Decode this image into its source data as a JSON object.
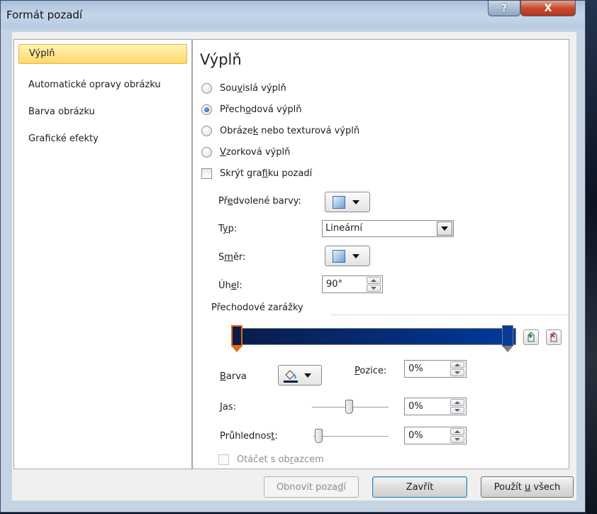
{
  "window": {
    "title": "Formát pozadí",
    "help_label": "?",
    "close_label": "X"
  },
  "nav": {
    "items": [
      {
        "label": "Výplň",
        "selected": true
      },
      {
        "label": "Automatické opravy obrázku",
        "selected": false
      },
      {
        "label": "Barva obrázku",
        "selected": false
      },
      {
        "label": "Grafické efekty",
        "selected": false
      }
    ]
  },
  "fill": {
    "heading": "Výplň",
    "options": [
      {
        "pre": "Sou",
        "ul": "v",
        "post": "islá výplň",
        "selected": false
      },
      {
        "pre": "Přech",
        "ul": "o",
        "post": "dová výplň",
        "selected": true
      },
      {
        "pre": "Obráze",
        "ul": "k",
        "post": " nebo texturová výplň",
        "selected": false
      },
      {
        "pre": "",
        "ul": "V",
        "post": "zorková výplň",
        "selected": false
      }
    ],
    "hide_graphics": {
      "pre": "Skrýt gra",
      "ul": "f",
      "post": "iku pozadí",
      "checked": false
    },
    "preset": {
      "pre": "Př",
      "ul": "e",
      "post": "dvolené barvy:"
    },
    "type": {
      "pre": "T",
      "ul": "y",
      "post": "p:",
      "value": "Lineární"
    },
    "direction": {
      "pre": "S",
      "ul": "m",
      "post": "ěr:"
    },
    "angle": {
      "pre": "Úh",
      "ul": "e",
      "post": "l:",
      "value": "90°"
    },
    "stops_group": {
      "label": "Přechodové zarážky"
    },
    "stops": [
      {
        "position": 0,
        "color": "#0a1c48",
        "selected": true
      },
      {
        "position": 1,
        "color": "#0a3a98",
        "selected": false
      }
    ],
    "color": {
      "pre": "",
      "ul": "B",
      "post": "arva"
    },
    "position": {
      "pre": "",
      "ul": "P",
      "post": "ozice:",
      "value": "0%"
    },
    "brightness": {
      "pre": "",
      "ul": "J",
      "post": "as:",
      "value": "0%",
      "level": 0.5
    },
    "transparency": {
      "pre": "Průhlednos",
      "ul": "t",
      "post": ":",
      "value": "0%",
      "level": 0.0
    },
    "rotate": {
      "pre": "Otáčet s ob",
      "ul": "r",
      "post": "azcem",
      "checked": false,
      "disabled": true
    }
  },
  "footer": {
    "reset": {
      "pre": "Obnovit poza",
      "ul": "d",
      "post": "í"
    },
    "close": {
      "pre": "Zavřít",
      "ul": "",
      "post": ""
    },
    "apply_all": {
      "pre": "Použít ",
      "ul": "u",
      "post": " všech"
    }
  },
  "colors": {
    "accent_selected_nav": "#ffd96a",
    "gradient_start": "#0a1c48",
    "gradient_end": "#003a9c",
    "stop_selected": "#e36c12"
  }
}
